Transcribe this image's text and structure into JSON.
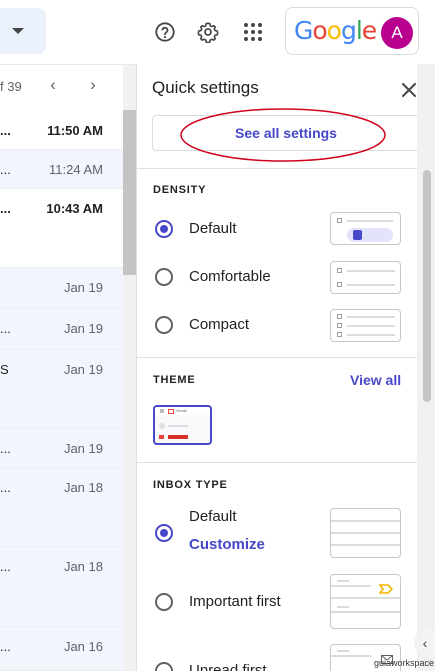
{
  "header": {
    "logo_text": "Google",
    "logo_colors": [
      "#4285F4",
      "#EA4335",
      "#FBBC05",
      "#4285F4",
      "#34A853",
      "#EA4335"
    ],
    "avatar_initial": "A",
    "avatar_color": "#b7008d",
    "icons": [
      "help-icon",
      "settings-icon",
      "apps-grid-icon"
    ]
  },
  "inbox": {
    "pager_text": "f 39",
    "rows": [
      {
        "prefix": "...",
        "date": "11:50 AM",
        "unread": true
      },
      {
        "prefix": "...",
        "date": "11:24 AM",
        "unread": false
      },
      {
        "prefix": "...",
        "date": "10:43 AM",
        "unread": true
      },
      {
        "prefix": "",
        "date": "Jan 19",
        "unread": false
      },
      {
        "prefix": "...",
        "date": "Jan 19",
        "unread": false
      },
      {
        "prefix": "S",
        "date": "Jan 19",
        "unread": false
      },
      {
        "prefix": "...",
        "date": "Jan 19",
        "unread": false
      },
      {
        "prefix": "...",
        "date": "Jan 18",
        "unread": false
      },
      {
        "prefix": "...",
        "date": "Jan 18",
        "unread": false
      },
      {
        "prefix": "...",
        "date": "Jan 16",
        "unread": false
      }
    ]
  },
  "quick_settings": {
    "title": "Quick settings",
    "see_all_label": "See all settings",
    "density": {
      "heading": "DENSITY",
      "options": [
        {
          "label": "Default",
          "selected": true
        },
        {
          "label": "Comfortable",
          "selected": false
        },
        {
          "label": "Compact",
          "selected": false
        }
      ]
    },
    "theme": {
      "heading": "THEME",
      "view_all_label": "View all",
      "thumb_logo_text": "Gmail"
    },
    "inbox_type": {
      "heading": "INBOX TYPE",
      "options": [
        {
          "label": "Default",
          "selected": true,
          "link": "Customize"
        },
        {
          "label": "Important first",
          "selected": false
        },
        {
          "label": "Unread first",
          "selected": false
        }
      ]
    }
  },
  "accent_color": "#4747c9",
  "annotation_color": "#d0021b",
  "watermark": "guiaworkspace"
}
